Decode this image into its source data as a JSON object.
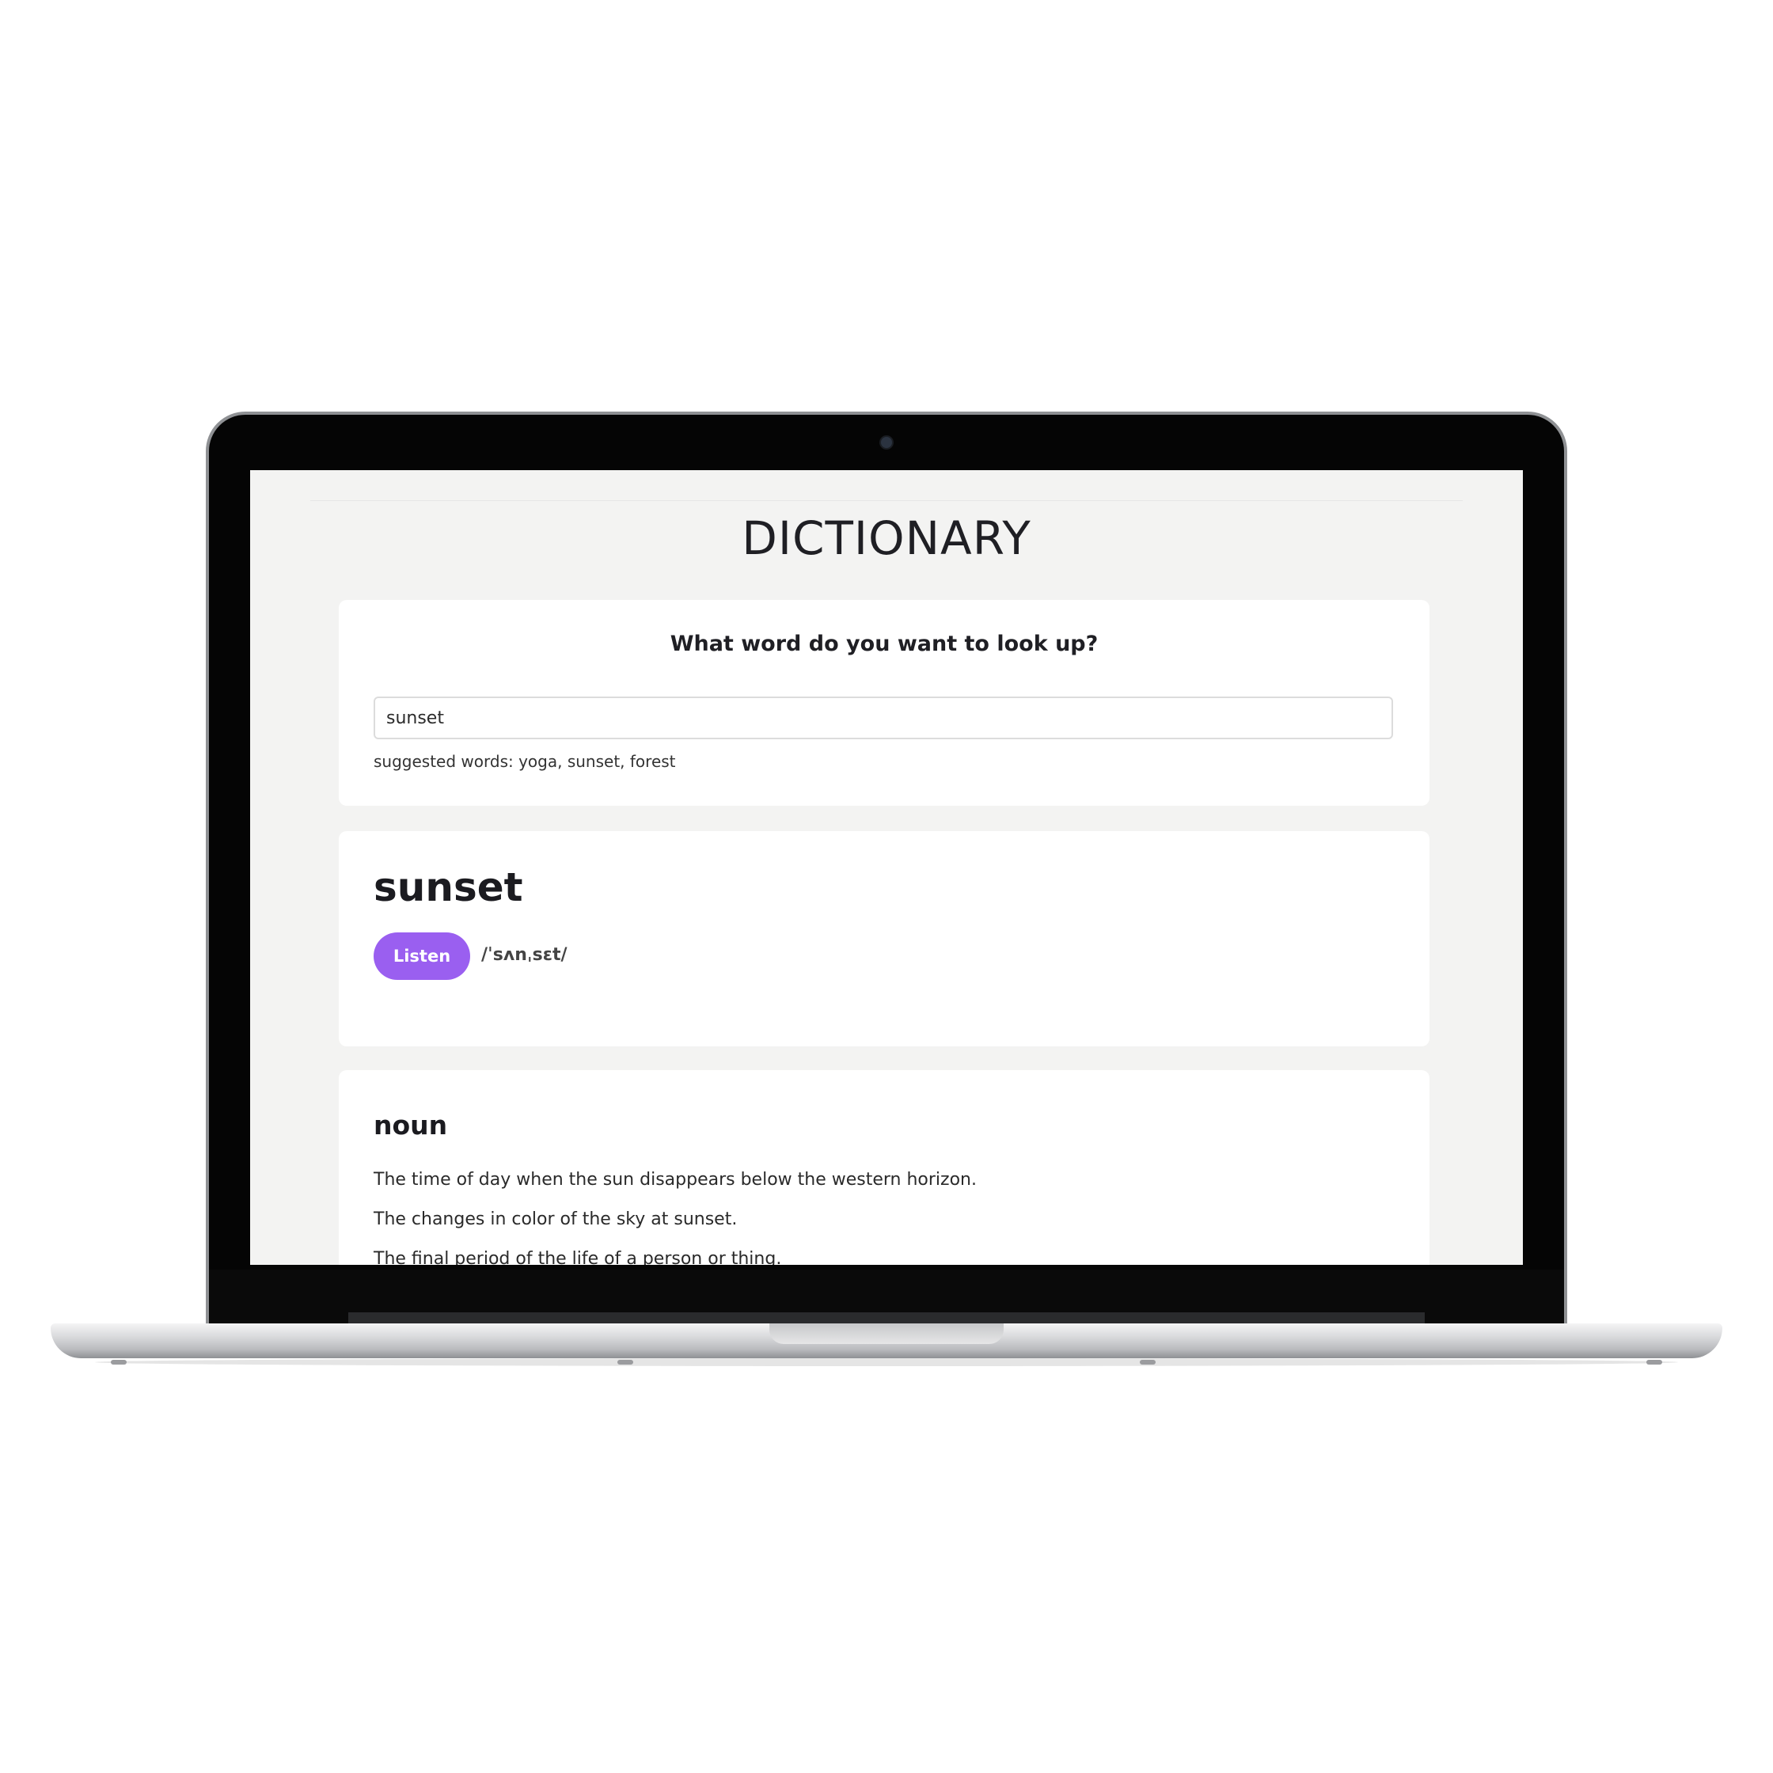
{
  "page": {
    "title": "DICTIONARY"
  },
  "search": {
    "question": "What word do you want to look up?",
    "value": "sunset",
    "suggestions": "suggested words: yoga, sunset, forest"
  },
  "entry": {
    "word": "sunset",
    "listen_label": "Listen",
    "phonetic": "/ˈsʌnˌsɛt/"
  },
  "meaning": {
    "part_of_speech": "noun",
    "definitions": [
      "The time of day when the sun disappears below the western horizon.",
      "The changes in color of the sky at sunset.",
      "The final period of the life of a person or thing."
    ]
  },
  "colors": {
    "accent": "#9a5ff0",
    "background": "#f3f3f2",
    "card": "#ffffff"
  }
}
